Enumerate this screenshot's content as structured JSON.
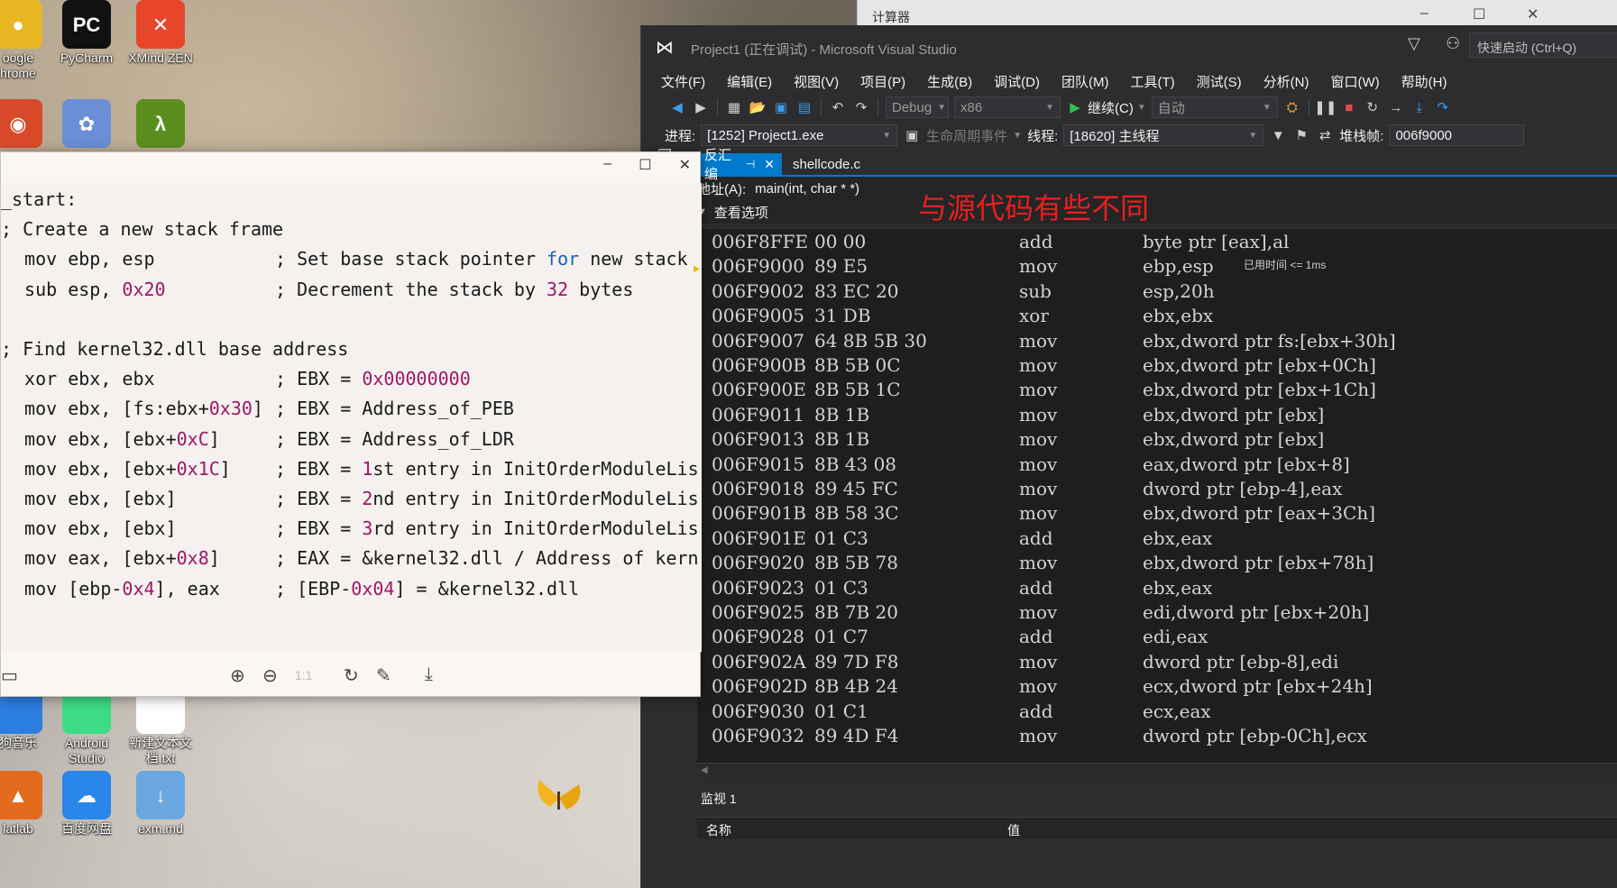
{
  "desktop": {
    "icons": [
      {
        "label": "oogle\nhrome",
        "glyph": "●",
        "color": "#e8b623"
      },
      {
        "label": "PyCharm",
        "glyph": "PC",
        "color": "#111111"
      },
      {
        "label": "XMind ZEN",
        "glyph": "✕",
        "color": "#e8462a"
      },
      {
        "label": "",
        "glyph": "◉",
        "color": "#d84a2a"
      },
      {
        "label": "",
        "glyph": "✿",
        "color": "#6a8fd6"
      },
      {
        "label": "",
        "glyph": "λ",
        "color": "#5a8f1f"
      },
      {
        "label": "狗音乐",
        "glyph": "",
        "color": "#2c7de0"
      },
      {
        "label": "Android\nStudio",
        "glyph": "",
        "color": "#3ddc84"
      },
      {
        "label": "新建文本文\n档.txt",
        "glyph": "",
        "color": "#ffffff"
      },
      {
        "label": "latlab",
        "glyph": "▲",
        "color": "#e36b1d"
      },
      {
        "label": "百度网盘",
        "glyph": "☁",
        "color": "#2a86e8"
      },
      {
        "label": "exm.md",
        "glyph": "↓",
        "color": "#6aa7e0"
      }
    ]
  },
  "calculator": {
    "title": "计算器"
  },
  "vs": {
    "title": "Project1 (正在调试) - Microsoft Visual Studio",
    "quick_launch_placeholder": "快速启动 (Ctrl+Q)",
    "menu": [
      "文件(F)",
      "编辑(E)",
      "视图(V)",
      "项目(P)",
      "生成(B)",
      "调试(D)",
      "团队(M)",
      "工具(T)",
      "测试(S)",
      "分析(N)",
      "窗口(W)",
      "帮助(H)"
    ],
    "toolbar": {
      "config": "Debug",
      "platform": "x86",
      "continue_label": "继续(C)",
      "auto_label": "自动"
    },
    "debugbar": {
      "process_label": "进程:",
      "process_value": "[1252] Project1.exe",
      "lifecycle_label": "生命周期事件",
      "thread_label": "线程:",
      "thread_value": "[18620] 主线程",
      "stackframe_label": "堆栈帧:",
      "stackframe_value": "006f9000"
    },
    "tabs": {
      "disasm": "反汇编",
      "shellcode": "shellcode.c"
    },
    "address_label": "地址(A):",
    "address_value": "main(int, char * *)",
    "annotation": "与源代码有些不同",
    "view_options": "查看选项",
    "elapsed": "已用时间 <= 1ms",
    "disasm_rows": [
      {
        "addr": "006F8FFE",
        "bytes": "00 00",
        "mn": "add",
        "op": "byte ptr [eax],al"
      },
      {
        "addr": "006F9000",
        "bytes": "89 E5",
        "mn": "mov",
        "op": "ebp,esp"
      },
      {
        "addr": "006F9002",
        "bytes": "83 EC 20",
        "mn": "sub",
        "op": "esp,20h"
      },
      {
        "addr": "006F9005",
        "bytes": "31 DB",
        "mn": "xor",
        "op": "ebx,ebx"
      },
      {
        "addr": "006F9007",
        "bytes": "64 8B 5B 30",
        "mn": "mov",
        "op": "ebx,dword ptr fs:[ebx+30h]"
      },
      {
        "addr": "006F900B",
        "bytes": "8B 5B 0C",
        "mn": "mov",
        "op": "ebx,dword ptr [ebx+0Ch]"
      },
      {
        "addr": "006F900E",
        "bytes": "8B 5B 1C",
        "mn": "mov",
        "op": "ebx,dword ptr [ebx+1Ch]"
      },
      {
        "addr": "006F9011",
        "bytes": "8B 1B",
        "mn": "mov",
        "op": "ebx,dword ptr [ebx]"
      },
      {
        "addr": "006F9013",
        "bytes": "8B 1B",
        "mn": "mov",
        "op": "ebx,dword ptr [ebx]"
      },
      {
        "addr": "006F9015",
        "bytes": "8B 43 08",
        "mn": "mov",
        "op": "eax,dword ptr [ebx+8]"
      },
      {
        "addr": "006F9018",
        "bytes": "89 45 FC",
        "mn": "mov",
        "op": "dword ptr [ebp-4],eax"
      },
      {
        "addr": "006F901B",
        "bytes": "8B 58 3C",
        "mn": "mov",
        "op": "ebx,dword ptr [eax+3Ch]"
      },
      {
        "addr": "006F901E",
        "bytes": "01 C3",
        "mn": "add",
        "op": "ebx,eax"
      },
      {
        "addr": "006F9020",
        "bytes": "8B 5B 78",
        "mn": "mov",
        "op": "ebx,dword ptr [ebx+78h]"
      },
      {
        "addr": "006F9023",
        "bytes": "01 C3",
        "mn": "add",
        "op": "ebx,eax"
      },
      {
        "addr": "006F9025",
        "bytes": "8B 7B 20",
        "mn": "mov",
        "op": "edi,dword ptr [ebx+20h]"
      },
      {
        "addr": "006F9028",
        "bytes": "01 C7",
        "mn": "add",
        "op": "edi,eax"
      },
      {
        "addr": "006F902A",
        "bytes": "89 7D F8",
        "mn": "mov",
        "op": "dword ptr [ebp-8],edi"
      },
      {
        "addr": "006F902D",
        "bytes": "8B 4B 24",
        "mn": "mov",
        "op": "ecx,dword ptr [ebx+24h]"
      },
      {
        "addr": "006F9030",
        "bytes": "01 C1",
        "mn": "add",
        "op": "ecx,eax"
      },
      {
        "addr": "006F9032",
        "bytes": "89 4D F4",
        "mn": "mov",
        "op": "dword ptr [ebp-0Ch],ecx"
      }
    ],
    "watch": {
      "title": "监视 1",
      "col_name": "名称",
      "col_value": "值"
    }
  },
  "viewer": {
    "code_lines": [
      [
        {
          "t": "_start:",
          "k": ""
        }
      ],
      [
        {
          "t": "; Create a new stack frame",
          "k": ""
        }
      ],
      [
        {
          "t": " mov ebp, esp",
          "k": ""
        },
        {
          "t": "; Set base stack pointer ",
          "k": "",
          "col": 2
        },
        {
          "t": "for",
          "k": "kw",
          "col": 2
        },
        {
          "t": " new stack",
          "k": "",
          "col": 2
        }
      ],
      [
        {
          "t": " sub esp, ",
          "k": ""
        },
        {
          "t": "0x20",
          "k": "num"
        },
        {
          "t": "; Decrement the stack by ",
          "k": "",
          "col": 2
        },
        {
          "t": "32",
          "k": "num",
          "col": 2
        },
        {
          "t": " bytes",
          "k": "",
          "col": 2
        }
      ],
      [],
      [
        {
          "t": "; Find kernel32.dll base address",
          "k": ""
        }
      ],
      [
        {
          "t": " xor ebx, ebx",
          "k": ""
        },
        {
          "t": "; EBX = ",
          "k": "",
          "col": 2
        },
        {
          "t": "0x00000000",
          "k": "num",
          "col": 2
        }
      ],
      [
        {
          "t": " mov ebx, [fs:ebx+",
          "k": ""
        },
        {
          "t": "0x30",
          "k": "num"
        },
        {
          "t": "]",
          "k": ""
        },
        {
          "t": "; EBX = Address_of_PEB",
          "k": "",
          "col": 2
        }
      ],
      [
        {
          "t": " mov ebx, [ebx+",
          "k": ""
        },
        {
          "t": "0xC",
          "k": "num"
        },
        {
          "t": "]",
          "k": ""
        },
        {
          "t": "; EBX = Address_of_LDR",
          "k": "",
          "col": 2
        }
      ],
      [
        {
          "t": " mov ebx, [ebx+",
          "k": ""
        },
        {
          "t": "0x1C",
          "k": "num"
        },
        {
          "t": "]",
          "k": ""
        },
        {
          "t": "; EBX = ",
          "k": "",
          "col": 2
        },
        {
          "t": "1",
          "k": "num",
          "col": 2
        },
        {
          "t": "st entry in InitOrderModuleLis",
          "k": "",
          "col": 2
        }
      ],
      [
        {
          "t": " mov ebx, [ebx]",
          "k": ""
        },
        {
          "t": "; EBX = ",
          "k": "",
          "col": 2
        },
        {
          "t": "2",
          "k": "num",
          "col": 2
        },
        {
          "t": "nd entry in InitOrderModuleLis",
          "k": "",
          "col": 2
        }
      ],
      [
        {
          "t": " mov ebx, [ebx]",
          "k": ""
        },
        {
          "t": "; EBX = ",
          "k": "",
          "col": 2
        },
        {
          "t": "3",
          "k": "num",
          "col": 2
        },
        {
          "t": "rd entry in InitOrderModuleLis",
          "k": "",
          "col": 2
        }
      ],
      [
        {
          "t": " mov eax, [ebx+",
          "k": ""
        },
        {
          "t": "0x8",
          "k": "num"
        },
        {
          "t": "]",
          "k": ""
        },
        {
          "t": "; EAX = &kernel32.dll / Address of kern",
          "k": "",
          "col": 2
        }
      ],
      [
        {
          "t": " mov [ebp-",
          "k": ""
        },
        {
          "t": "0x4",
          "k": "num"
        },
        {
          "t": "], eax",
          "k": ""
        },
        {
          "t": "; [EBP-",
          "k": "",
          "col": 2
        },
        {
          "t": "0x04",
          "k": "num",
          "col": 2
        },
        {
          "t": "] = &kernel32.dll",
          "k": "",
          "col": 2
        }
      ]
    ],
    "controls": {
      "minimize": "–",
      "maximize": "☐",
      "close": "✕"
    }
  }
}
